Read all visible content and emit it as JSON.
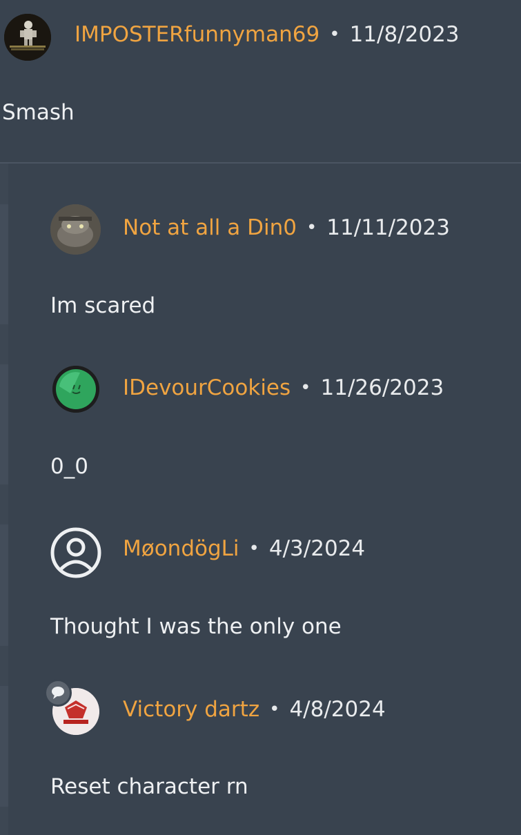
{
  "main_comment": {
    "username": "IMPOSTERfunnyman69",
    "separator": "•",
    "date": "11/8/2023",
    "text": "Smash"
  },
  "replies": [
    {
      "username": "Not at all a Din0",
      "separator": "•",
      "date": "11/11/2023",
      "text": "Im scared"
    },
    {
      "username": "IDevourCookies",
      "separator": "•",
      "date": "11/26/2023",
      "text": "0_0"
    },
    {
      "username": "MøondögLi",
      "separator": "•",
      "date": "4/3/2024",
      "text": "Thought I was the only one"
    },
    {
      "username": "Victory dartz",
      "separator": "•",
      "date": "4/8/2024",
      "text": "Reset character rn"
    }
  ],
  "colors": {
    "background": "#39434f",
    "username": "#f0a441",
    "text": "#eef0f2",
    "thread_line": "#434d5a"
  },
  "icons": {
    "default_avatar": "user-circle-icon",
    "badge": "speech-bubble-icon"
  }
}
